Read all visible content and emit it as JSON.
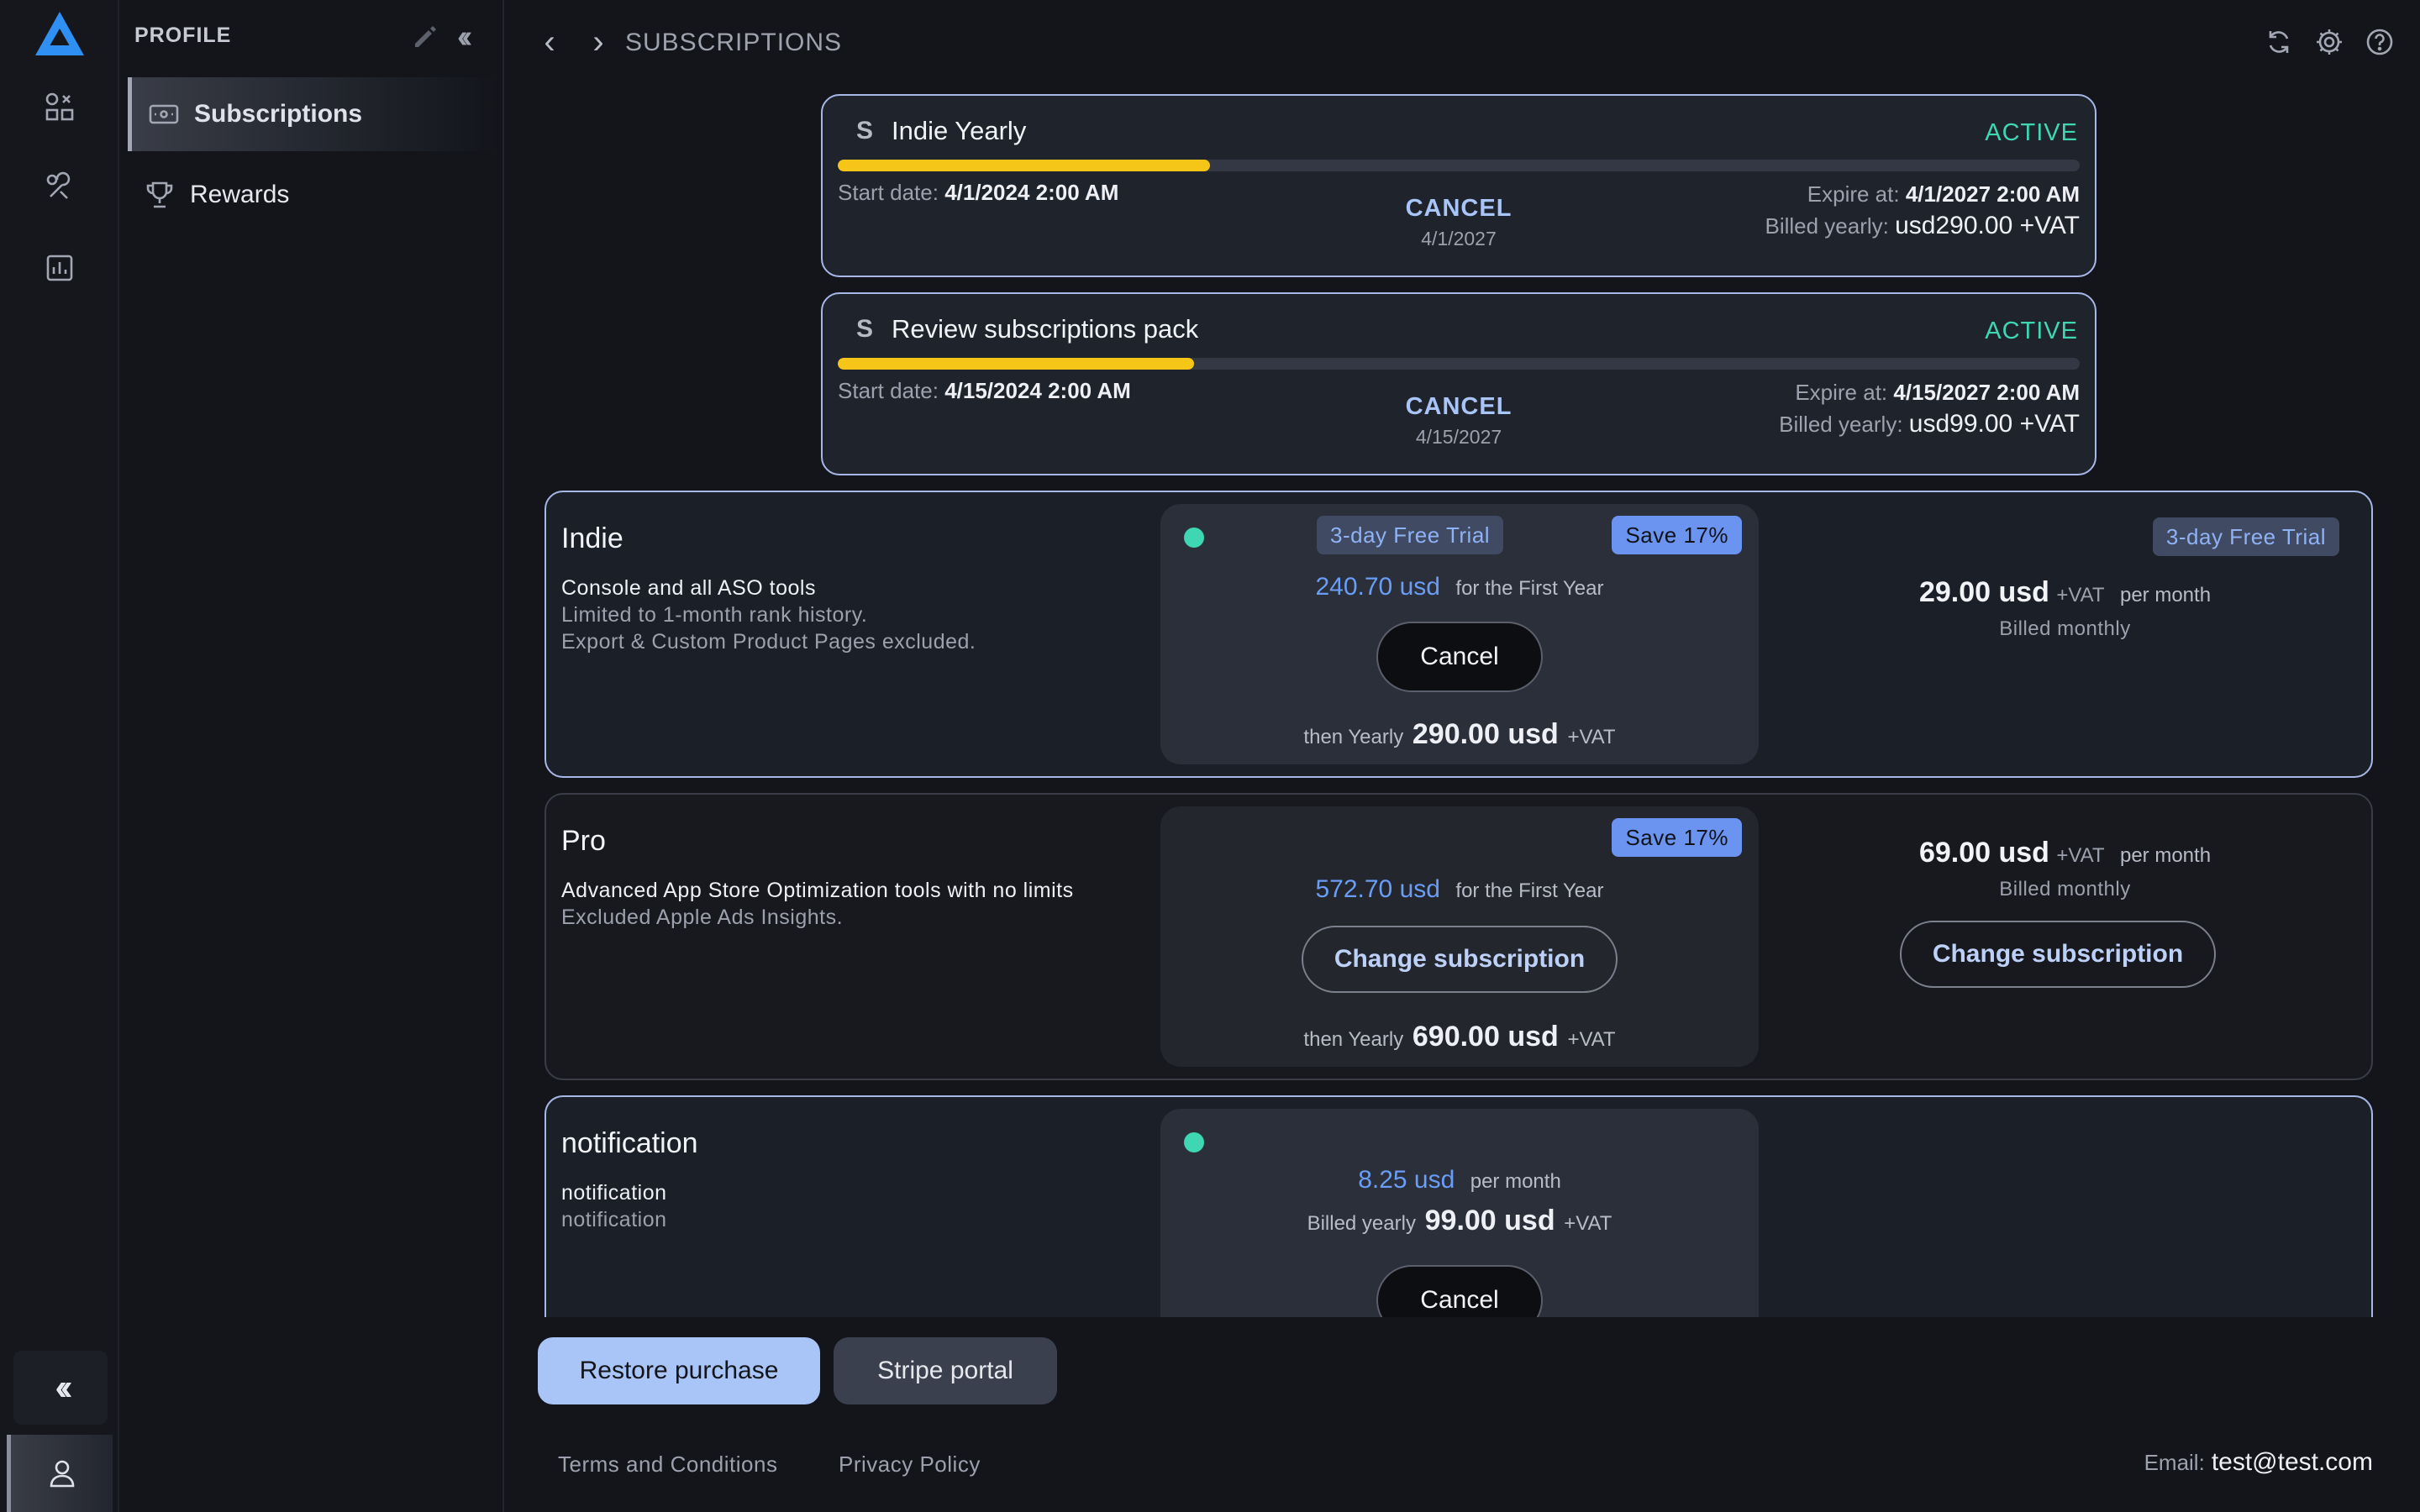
{
  "rail": {
    "logo": "app-logo",
    "icons": [
      "apps-grid-icon",
      "tools-icon",
      "analytics-icon"
    ],
    "collapse_icon": "double-chevron-left-icon",
    "user_icon": "user-icon"
  },
  "sidebar": {
    "title": "PROFILE",
    "items": [
      {
        "label": "Subscriptions",
        "icon": "billing-icon",
        "active": true
      },
      {
        "label": "Rewards",
        "icon": "trophy-icon",
        "active": false
      }
    ]
  },
  "topbar": {
    "title": "SUBSCRIPTIONS",
    "icons": [
      "refresh-icon",
      "settings-icon",
      "help-icon"
    ]
  },
  "active_subscriptions": [
    {
      "name": "Indie Yearly",
      "status": "ACTIVE",
      "progress": 0.3,
      "start_label": "Start date:",
      "start_value": "4/1/2024 2:00 AM",
      "cancel_label": "CANCEL",
      "cancel_date": "4/1/2027",
      "expire_label": "Expire at:",
      "expire_value": "4/1/2027 2:00 AM",
      "billed_label": "Billed yearly:",
      "billed_value": "usd290.00 +VAT"
    },
    {
      "name": "Review subscriptions pack",
      "status": "ACTIVE",
      "progress": 0.287,
      "start_label": "Start date:",
      "start_value": "4/15/2024 2:00 AM",
      "cancel_label": "CANCEL",
      "cancel_date": "4/15/2027",
      "expire_label": "Expire at:",
      "expire_value": "4/15/2027 2:00 AM",
      "billed_label": "Billed yearly:",
      "billed_value": "usd99.00 +VAT"
    }
  ],
  "plans": [
    {
      "name": "Indie",
      "desc_main": "Console and all ASO tools",
      "desc_extra": [
        "Limited to 1-month rank history.",
        "Export & Custom Product Pages excluded."
      ],
      "trial_badge": "3-day Free Trial",
      "save_badge": "Save 17%",
      "first_year_amount": "240.70 usd",
      "first_year_label": "for the First Year",
      "action_label": "Cancel",
      "then_label": "then Yearly",
      "then_amount": "290.00 usd",
      "then_vat": "+VAT",
      "monthly_trial_badge": "3-day Free Trial",
      "monthly_amount": "29.00 usd",
      "monthly_vat": "+VAT",
      "monthly_per": "per month",
      "monthly_billed": "Billed monthly"
    },
    {
      "name": "Pro",
      "desc_main": "Advanced App Store Optimization tools with no limits",
      "desc_extra": [
        "Excluded Apple Ads Insights."
      ],
      "save_badge": "Save 17%",
      "first_year_amount": "572.70 usd",
      "first_year_label": "for the First Year",
      "action_label": "Change subscription",
      "then_label": "then Yearly",
      "then_amount": "690.00 usd",
      "then_vat": "+VAT",
      "monthly_amount": "69.00 usd",
      "monthly_vat": "+VAT",
      "monthly_per": "per month",
      "monthly_billed": "Billed monthly",
      "monthly_action_label": "Change subscription"
    },
    {
      "name": "notification",
      "desc_main": "notification",
      "desc_extra": [
        "notification"
      ],
      "amount": "8.25 usd",
      "per": "per month",
      "billed_label": "Billed yearly",
      "billed_amount": "99.00 usd",
      "billed_vat": "+VAT",
      "action_label": "Cancel"
    }
  ],
  "footer": {
    "restore_label": "Restore purchase",
    "stripe_label": "Stripe portal",
    "terms_label": "Terms and Conditions",
    "privacy_label": "Privacy Policy",
    "email_label": "Email:",
    "email_value": "test@test.com"
  },
  "colors": {
    "accent": "#a9c4f7",
    "active_status": "#3fd6b3",
    "progress": "#f5c518",
    "price_blue": "#6a9df5"
  }
}
